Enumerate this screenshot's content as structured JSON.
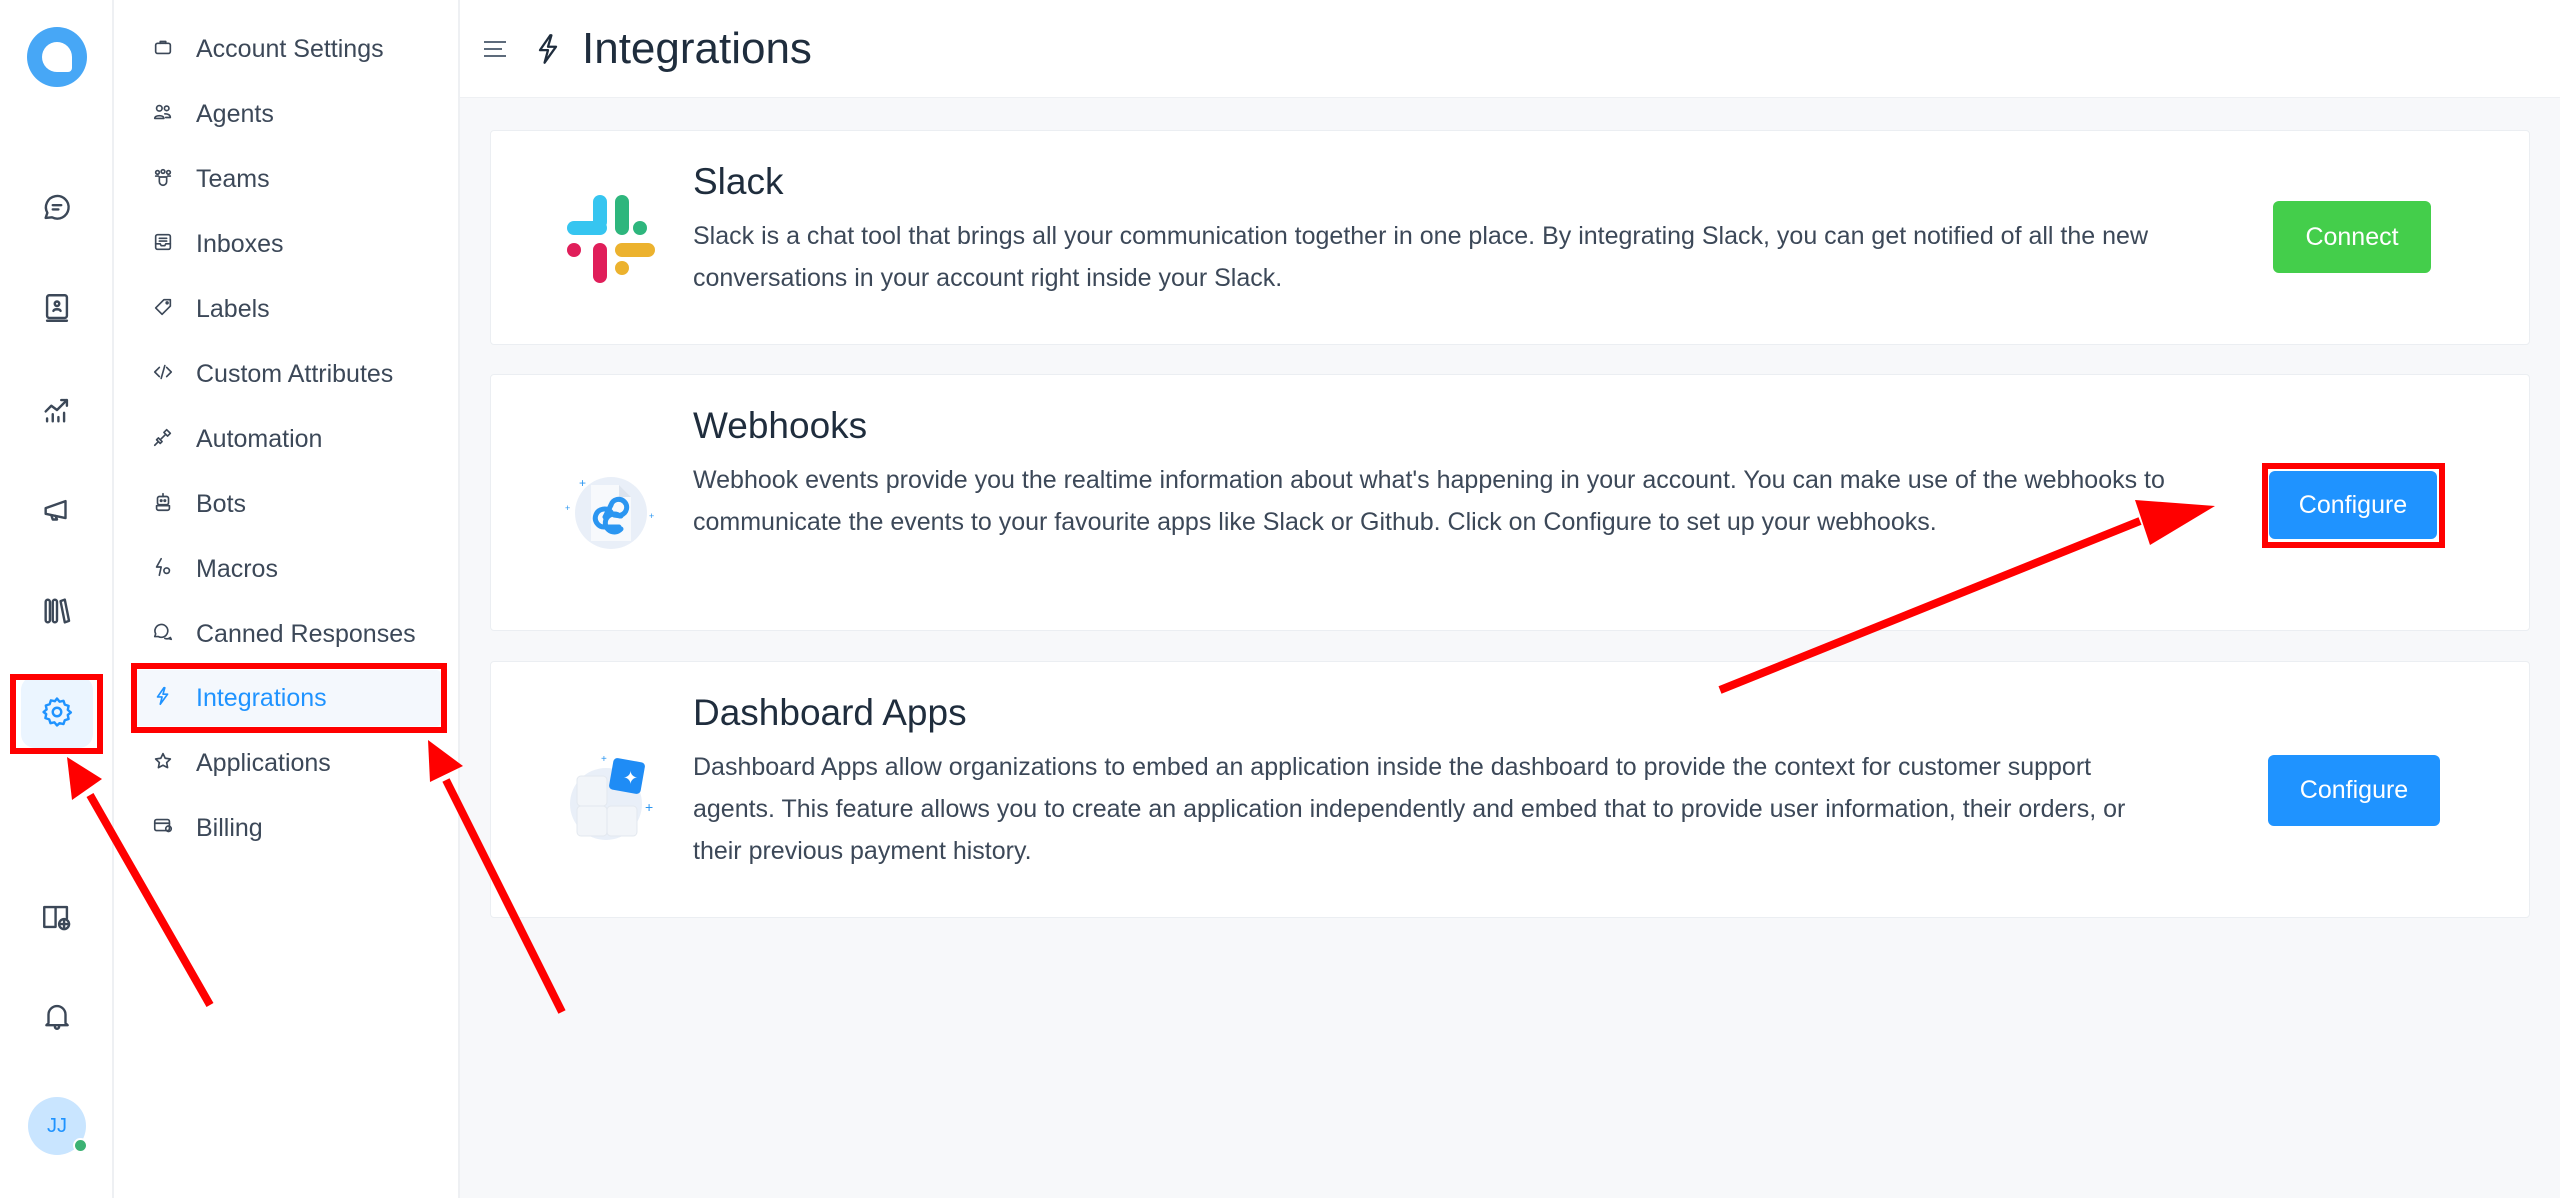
{
  "header": {
    "title": "Integrations",
    "menu_icon": "hamburger-icon",
    "title_icon": "bolt-icon"
  },
  "rail": {
    "items": [
      {
        "name": "conversations",
        "icon": "chat-icon"
      },
      {
        "name": "contacts",
        "icon": "contact-book-icon"
      },
      {
        "name": "reports",
        "icon": "chart-icon"
      },
      {
        "name": "campaigns",
        "icon": "megaphone-icon"
      },
      {
        "name": "library",
        "icon": "library-icon"
      },
      {
        "name": "settings",
        "icon": "gear-icon",
        "active": true
      },
      {
        "name": "help-center",
        "icon": "book-globe-icon"
      },
      {
        "name": "notifications",
        "icon": "bell-icon"
      }
    ],
    "avatar": {
      "initials": "JJ",
      "status": "online",
      "status_color": "#3bb273"
    }
  },
  "sidebar": {
    "items": [
      {
        "label": "Account Settings",
        "icon": "briefcase-icon"
      },
      {
        "label": "Agents",
        "icon": "people-icon"
      },
      {
        "label": "Teams",
        "icon": "team-icon"
      },
      {
        "label": "Inboxes",
        "icon": "inbox-icon"
      },
      {
        "label": "Labels",
        "icon": "tag-icon"
      },
      {
        "label": "Custom Attributes",
        "icon": "code-icon"
      },
      {
        "label": "Automation",
        "icon": "plug-icon"
      },
      {
        "label": "Bots",
        "icon": "bot-icon"
      },
      {
        "label": "Macros",
        "icon": "macro-icon"
      },
      {
        "label": "Canned Responses",
        "icon": "chat-bubbles-icon"
      },
      {
        "label": "Integrations",
        "icon": "bolt-icon",
        "active": true
      },
      {
        "label": "Applications",
        "icon": "star-icon"
      },
      {
        "label": "Billing",
        "icon": "billing-icon"
      }
    ]
  },
  "integrations": [
    {
      "title": "Slack",
      "description": "Slack is a chat tool that brings all your communication together in one place. By integrating Slack, you can get notified of all the new conversations in your account right inside your Slack.",
      "button": "Connect",
      "button_color": "#44ce4b"
    },
    {
      "title": "Webhooks",
      "description": "Webhook events provide you the realtime information about what's happening in your account. You can make use of the webhooks to communicate the events to your favourite apps like Slack or Github. Click on Configure to set up your webhooks.",
      "button": "Configure",
      "button_color": "#1f93ff"
    },
    {
      "title": "Dashboard Apps",
      "description": "Dashboard Apps allow organizations to embed an application inside the dashboard to provide the context for customer support agents. This feature allows you to create an application independently and embed that to provide user information, their orders, or their previous payment history.",
      "button": "Configure",
      "button_color": "#1f93ff"
    }
  ],
  "colors": {
    "accent": "#1f93ff",
    "success": "#44ce4b",
    "annotation": "#ff0000"
  }
}
